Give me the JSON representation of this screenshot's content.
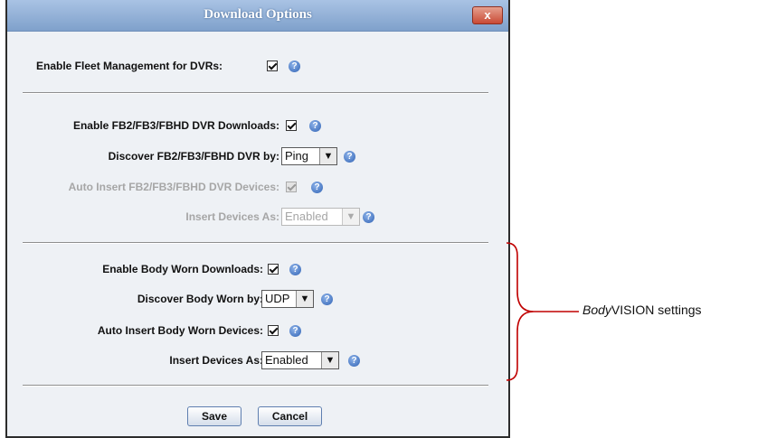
{
  "dialog": {
    "title": "Download Options",
    "close_glyph": "x",
    "fleet": {
      "label": "Enable Fleet Management for DVRs:",
      "checked": true
    },
    "fb": {
      "enable_label": "Enable FB2/FB3/FBHD DVR Downloads:",
      "discover_label": "Discover FB2/FB3/FBHD DVR by:",
      "discover_value": "Ping",
      "auto_insert_label": "Auto Insert FB2/FB3/FBHD DVR Devices:",
      "insert_as_label": "Insert Devices As:",
      "insert_as_value": "Enabled"
    },
    "body_worn": {
      "enable_label": "Enable Body Worn Downloads:",
      "discover_label": "Discover Body Worn by:",
      "discover_value": "UDP",
      "auto_insert_label": "Auto Insert Body Worn Devices:",
      "insert_as_label": "Insert Devices As:",
      "insert_as_value": "Enabled"
    },
    "buttons": {
      "save": "Save",
      "cancel": "Cancel"
    }
  },
  "help_glyph": "?",
  "dropdown_glyph": "▼",
  "annotation": {
    "emphasis": "Body",
    "rest": "VISION settings"
  },
  "colors": {
    "title_bar": "#8eabd6",
    "close_button": "#d45a44",
    "help_icon": "#2f62b4",
    "bracket": "#c00000"
  }
}
